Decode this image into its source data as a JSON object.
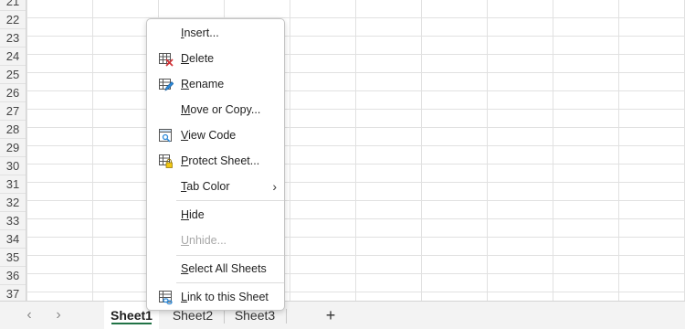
{
  "grid": {
    "rows": [
      "21",
      "22",
      "23",
      "24",
      "25",
      "26",
      "27",
      "28",
      "29",
      "30",
      "31",
      "32",
      "33",
      "34",
      "35",
      "36",
      "37"
    ]
  },
  "tabbar": {
    "prev_icon": "chevron-left-icon",
    "next_icon": "chevron-right-icon",
    "sheets": [
      "Sheet1",
      "Sheet2",
      "Sheet3"
    ],
    "active_sheet": "Sheet1",
    "add_label": "+",
    "accent_color": "#217346"
  },
  "context_menu": {
    "insert": {
      "accel": "I",
      "rest": "nsert..."
    },
    "delete": {
      "accel": "D",
      "rest": "elete",
      "icon": "delete-sheet-icon"
    },
    "rename": {
      "accel": "R",
      "rest": "ename",
      "icon": "rename-sheet-icon"
    },
    "move_copy": {
      "accel": "M",
      "rest": "ove or Copy..."
    },
    "view_code": {
      "accel": "V",
      "rest": "iew Code",
      "icon": "view-code-icon"
    },
    "protect_sheet": {
      "accel": "P",
      "rest": "rotect Sheet...",
      "icon": "protect-sheet-icon"
    },
    "tab_color": {
      "accel": "T",
      "rest": "ab Color",
      "arrow": "›"
    },
    "hide": {
      "accel": "H",
      "rest": "ide"
    },
    "unhide": {
      "accel": "U",
      "rest": "nhide...",
      "disabled": true
    },
    "select_all": {
      "accel": "S",
      "rest": "elect All Sheets"
    },
    "link_sheet": {
      "accel": "L",
      "rest": "ink to this Sheet",
      "icon": "link-sheet-icon"
    }
  }
}
